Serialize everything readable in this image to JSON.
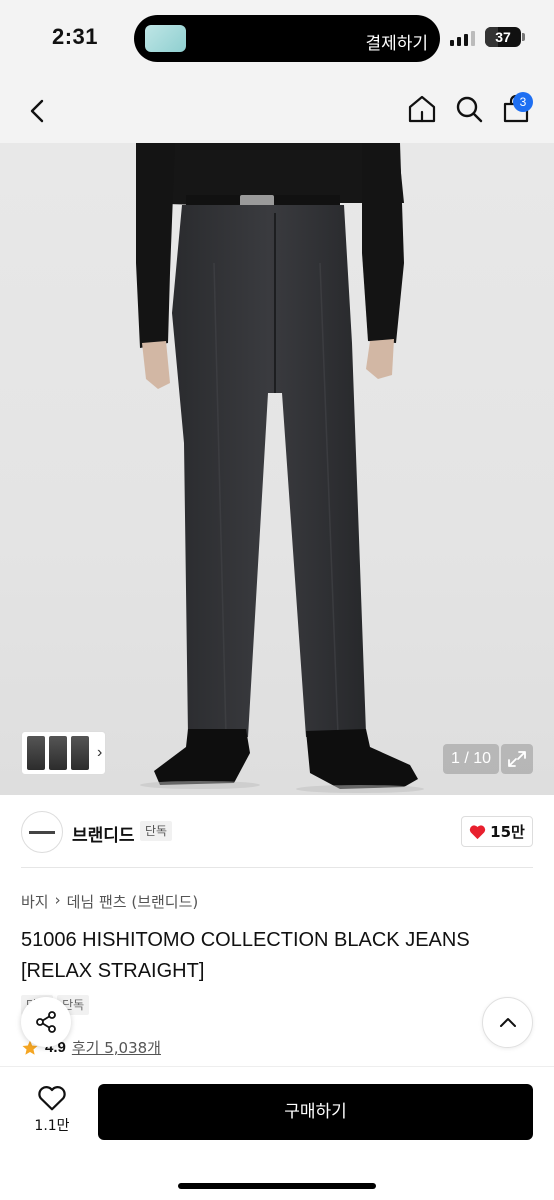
{
  "status_bar": {
    "time": "2:31",
    "live_activity_text": "결제하기",
    "battery": "37",
    "battery_level": 0.37
  },
  "nav": {
    "cart_count": "3"
  },
  "gallery": {
    "counter": "1 / 10"
  },
  "brand": {
    "name": "브랜디드",
    "badge": "단독",
    "likes": "15만"
  },
  "product": {
    "breadcrumb": [
      "바지",
      "데님 팬츠 (브랜디드)"
    ],
    "title": "51006 HISHITOMO COLLECTION BLACK JEANS [RELAX STRAIGHT]",
    "tags": [
      "단독",
      "단독"
    ],
    "rating": "4.9",
    "reviews": "후기 5,038개"
  },
  "bottom_bar": {
    "wish_count": "1.1만",
    "buy_label": "구매하기"
  },
  "colors": {
    "accent_badge": "#1e6ff2",
    "like_heart": "#e8202e",
    "star": "#f5a623",
    "buy_button": "#000000"
  },
  "icons": [
    "back-icon",
    "home-icon",
    "search-icon",
    "cart-icon",
    "chevron-right-icon",
    "expand-icon",
    "heart-icon",
    "share-icon",
    "chevron-up-icon",
    "star-icon"
  ]
}
